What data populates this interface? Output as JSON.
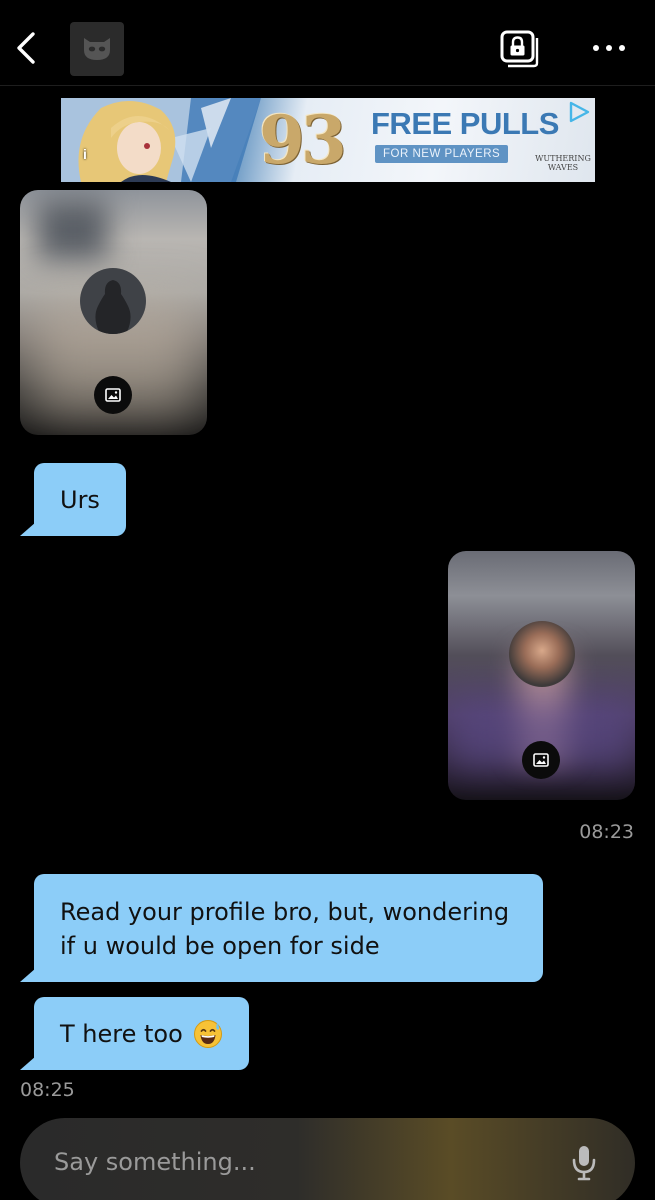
{
  "header": {
    "back_icon": "chevron-left-icon",
    "avatar_icon": "mask-icon",
    "album_icon": "private-album-icon",
    "more_icon": "more-horizontal-icon"
  },
  "ad": {
    "number": "93",
    "headline": "FREE PULLS",
    "subline": "FOR NEW PLAYERS",
    "brand": "WUTHERING WAVES",
    "info_glyph": "i",
    "colors": {
      "headline": "#3b79b4",
      "number": "#c9a86a"
    }
  },
  "messages": [
    {
      "type": "photo",
      "direction": "incoming",
      "icon": "image-icon"
    },
    {
      "type": "text",
      "direction": "incoming",
      "text": "Urs"
    },
    {
      "type": "photo",
      "direction": "outgoing",
      "icon": "image-icon"
    },
    {
      "type": "text",
      "direction": "incoming",
      "text": "Read your profile bro, but, wondering if u would be open for side"
    },
    {
      "type": "text",
      "direction": "incoming",
      "text": "T here too",
      "emoji": "grinning-sweat-emoji"
    }
  ],
  "timestamps": {
    "outgoing": "08:23",
    "incoming": "08:25"
  },
  "composer": {
    "placeholder": "Say something...",
    "mic_icon": "microphone-icon"
  },
  "colors": {
    "bubble": "#8ccdf8",
    "background": "#000000",
    "timestamp": "#9a9a9a"
  }
}
